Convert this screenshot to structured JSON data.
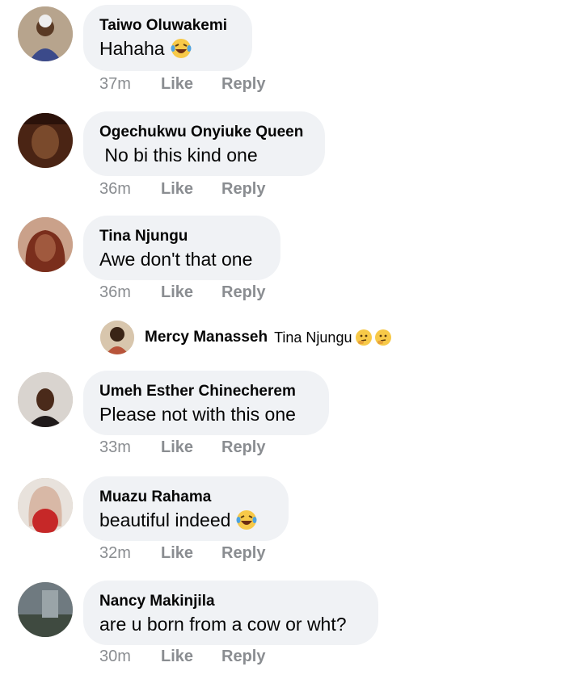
{
  "comments": [
    {
      "name": "Taiwo Oluwakemi",
      "text": "Hahaha",
      "time": "37m",
      "like": "Like",
      "reply": "Reply",
      "emoji": "laughing-tears-icon"
    },
    {
      "name": "Ogechukwu Onyiuke Queen",
      "text": " No bi this kind one",
      "time": "36m",
      "like": "Like",
      "reply": "Reply"
    },
    {
      "name": "Tina Njungu",
      "text": "Awe don't that one",
      "time": "36m",
      "like": "Like",
      "reply": "Reply"
    },
    {
      "name": "Umeh Esther Chinecherem",
      "text": "Please not with this one",
      "time": "33m",
      "like": "Like",
      "reply": "Reply"
    },
    {
      "name": "Muazu Rahama",
      "text": "beautiful indeed",
      "time": "32m",
      "like": "Like",
      "reply": "Reply",
      "emoji": "laughing-tears-icon"
    },
    {
      "name": "Nancy Makinjila",
      "text": "are u born from a cow or wht?",
      "time": "30m",
      "like": "Like",
      "reply": "Reply"
    }
  ],
  "reply": {
    "name": "Mercy Manasseh",
    "text": "Tina Njungu",
    "emoji": "thinking-face-icon"
  },
  "colors": {
    "bubble": "#f0f2f5",
    "meta": "#8a8d91",
    "text": "#050505"
  }
}
